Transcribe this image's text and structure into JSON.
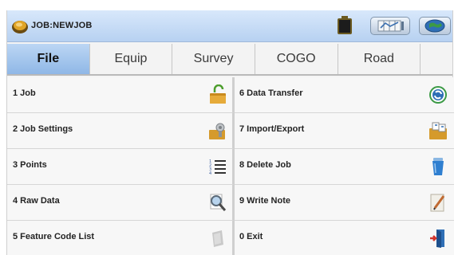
{
  "titlebar": {
    "title": "JOB:NEWJOB",
    "icons": [
      "survey-logo-icon",
      "battery-icon",
      "satellite-status-icon",
      "globe-icon"
    ]
  },
  "tabs": [
    {
      "label": "File",
      "active": true
    },
    {
      "label": "Equip",
      "active": false
    },
    {
      "label": "Survey",
      "active": false
    },
    {
      "label": "COGO",
      "active": false
    },
    {
      "label": "Road",
      "active": false
    }
  ],
  "menu": {
    "left": [
      {
        "label": "1 Job",
        "icon": "open-folder-icon"
      },
      {
        "label": "2 Job Settings",
        "icon": "job-settings-icon"
      },
      {
        "label": "3 Points",
        "icon": "points-list-icon"
      },
      {
        "label": "4 Raw Data",
        "icon": "magnifier-icon"
      },
      {
        "label": "5 Feature Code List",
        "icon": "feature-code-icon"
      }
    ],
    "right": [
      {
        "label": "6 Data Transfer",
        "icon": "data-transfer-icon"
      },
      {
        "label": "7 Import/Export",
        "icon": "import-export-icon"
      },
      {
        "label": "8 Delete Job",
        "icon": "trash-icon"
      },
      {
        "label": "9 Write Note",
        "icon": "note-pencil-icon"
      },
      {
        "label": "0 Exit",
        "icon": "exit-door-icon"
      }
    ]
  },
  "colors": {
    "titlebar": "#c6dcf6",
    "active_tab": "#a6c8ee",
    "background": "#f7f7f7"
  }
}
